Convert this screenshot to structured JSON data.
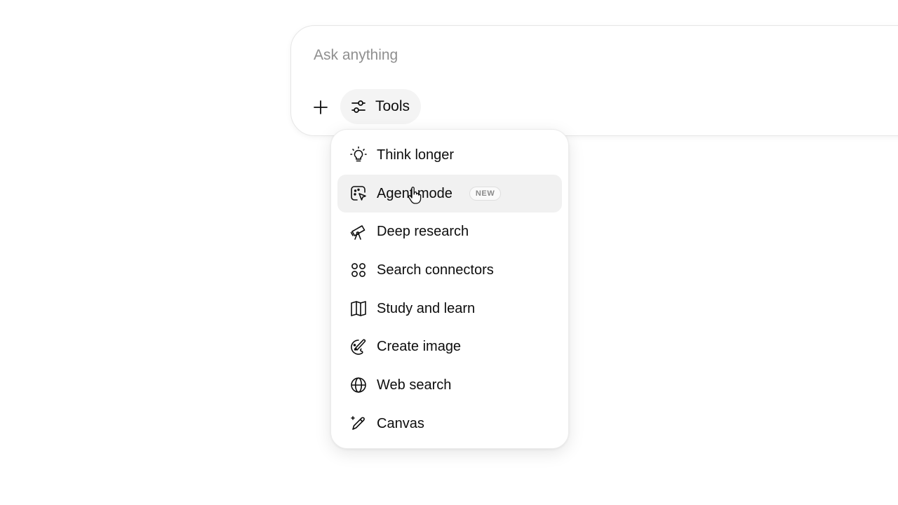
{
  "composer": {
    "placeholder": "Ask anything",
    "tools_label": "Tools"
  },
  "menu": {
    "items": [
      {
        "label": "Think longer",
        "icon": "lightbulb-icon"
      },
      {
        "label": "Agent mode",
        "icon": "agent-icon",
        "badge": "NEW",
        "hovered": true
      },
      {
        "label": "Deep research",
        "icon": "telescope-icon"
      },
      {
        "label": "Search connectors",
        "icon": "connectors-icon"
      },
      {
        "label": "Study and learn",
        "icon": "book-icon"
      },
      {
        "label": "Create image",
        "icon": "palette-icon"
      },
      {
        "label": "Web search",
        "icon": "globe-icon"
      },
      {
        "label": "Canvas",
        "icon": "pencil-sparkle-icon"
      }
    ]
  },
  "colors": {
    "text": "#0d0d0d",
    "placeholder": "#8f8f8f",
    "hover_bg": "#f1f1f1",
    "tools_bg": "#f4f4f4",
    "badge_text": "#8a8a8a"
  }
}
